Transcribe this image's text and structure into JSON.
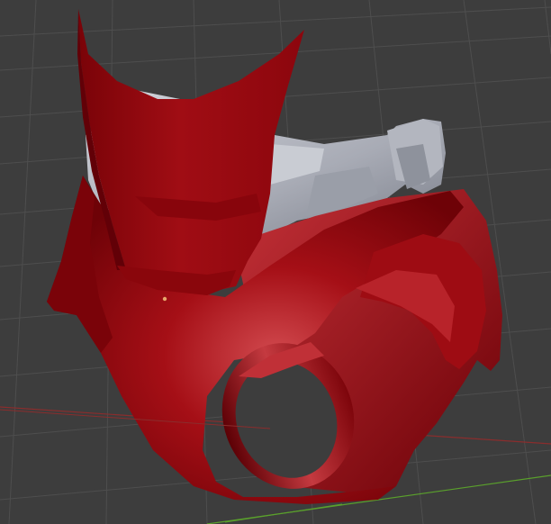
{
  "viewport": {
    "background": "#3d3d3d",
    "grid_line_color": "#4d4d4d",
    "x_axis_color": "#8a2d2d",
    "y_axis_color": "#5aa02c"
  },
  "scene": {
    "object_main_color": "#a00d14",
    "object_dark_color": "#6a0006",
    "object_highlight_color": "#d24a4f",
    "inner_part_color": "#b9bcc4",
    "inner_part_shadow": "#7d818c",
    "origin_marker_color": "#e6a86b"
  }
}
